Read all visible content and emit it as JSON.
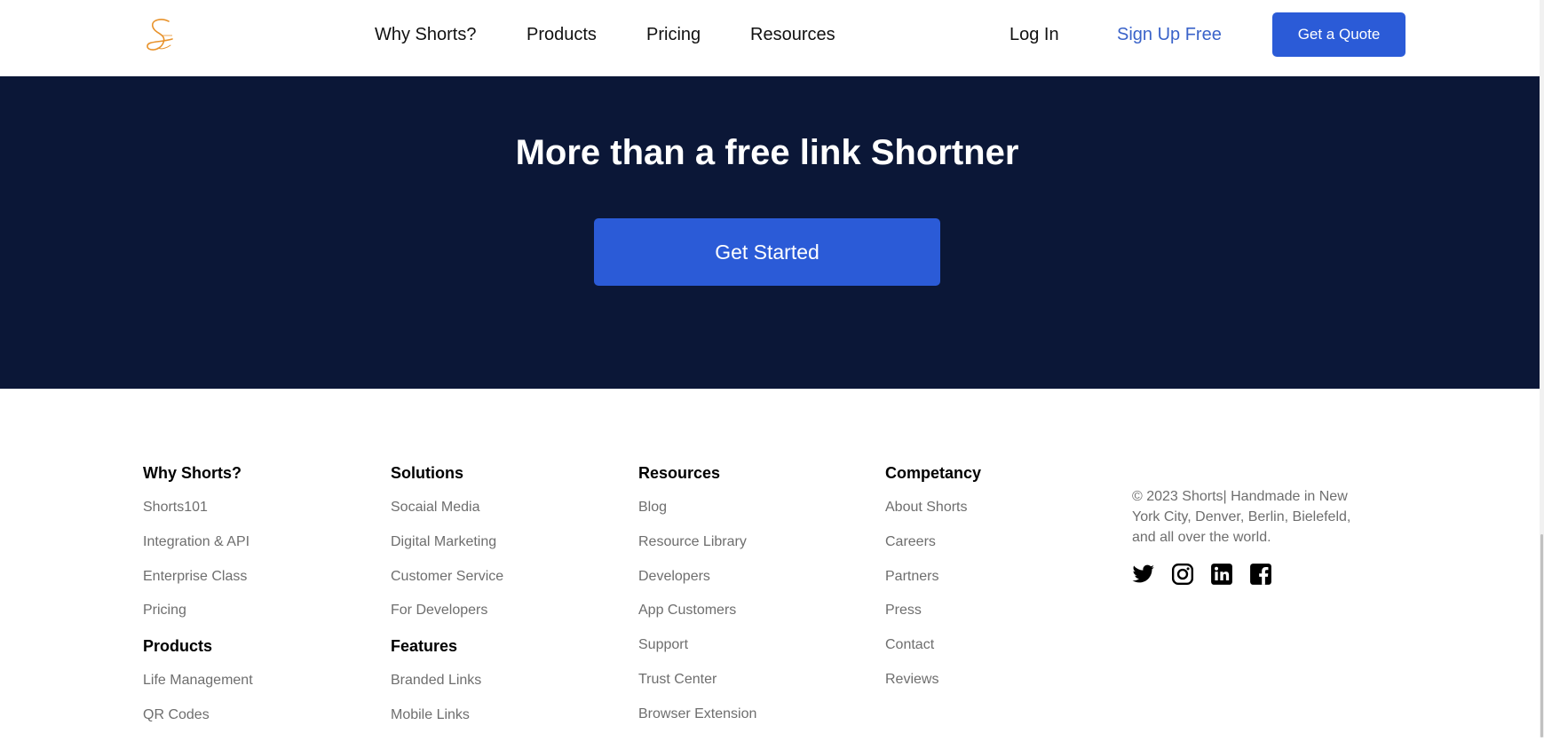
{
  "header": {
    "logo_icon": "shorts-logo-icon",
    "nav": [
      "Why Shorts?",
      "Products",
      "Pricing",
      "Resources"
    ],
    "login": "Log In",
    "signup": "Sign Up Free",
    "quote": "Get a Quote"
  },
  "hero": {
    "title": "More than a free link Shortner",
    "cta": "Get Started"
  },
  "footer": {
    "columns": [
      {
        "sections": [
          {
            "heading": "Why Shorts?",
            "links": [
              "Shorts101",
              "Integration & API",
              "Enterprise Class",
              "Pricing"
            ]
          },
          {
            "heading": "Products",
            "links": [
              "Life Management",
              "QR Codes"
            ]
          }
        ]
      },
      {
        "sections": [
          {
            "heading": "Solutions",
            "links": [
              "Socaial Media",
              "Digital Marketing",
              "Customer Service",
              "For Developers"
            ]
          },
          {
            "heading": "Features",
            "links": [
              "Branded Links",
              "Mobile Links"
            ]
          }
        ]
      },
      {
        "sections": [
          {
            "heading": "Resources",
            "links": [
              "Blog",
              "Resource Library",
              "Developers",
              "App Customers",
              "Support",
              "Trust Center",
              "Browser Extension"
            ]
          }
        ]
      },
      {
        "sections": [
          {
            "heading": "Competancy",
            "links": [
              "About Shorts",
              "Careers",
              "Partners",
              "Press",
              "Contact",
              "Reviews"
            ]
          }
        ]
      }
    ],
    "copyright": "© 2023 Shorts| Handmade in New York City, Denver, Berlin, Bielefeld, and all over the world.",
    "social_icons": [
      "twitter-icon",
      "instagram-icon",
      "linkedin-icon",
      "facebook-icon"
    ]
  },
  "colors": {
    "brand_blue": "#2b5bd7",
    "hero_bg": "#0b1737",
    "signup_text": "#3a63c9",
    "logo_orange": "#e8922a",
    "muted_text": "#6e6e6e"
  }
}
